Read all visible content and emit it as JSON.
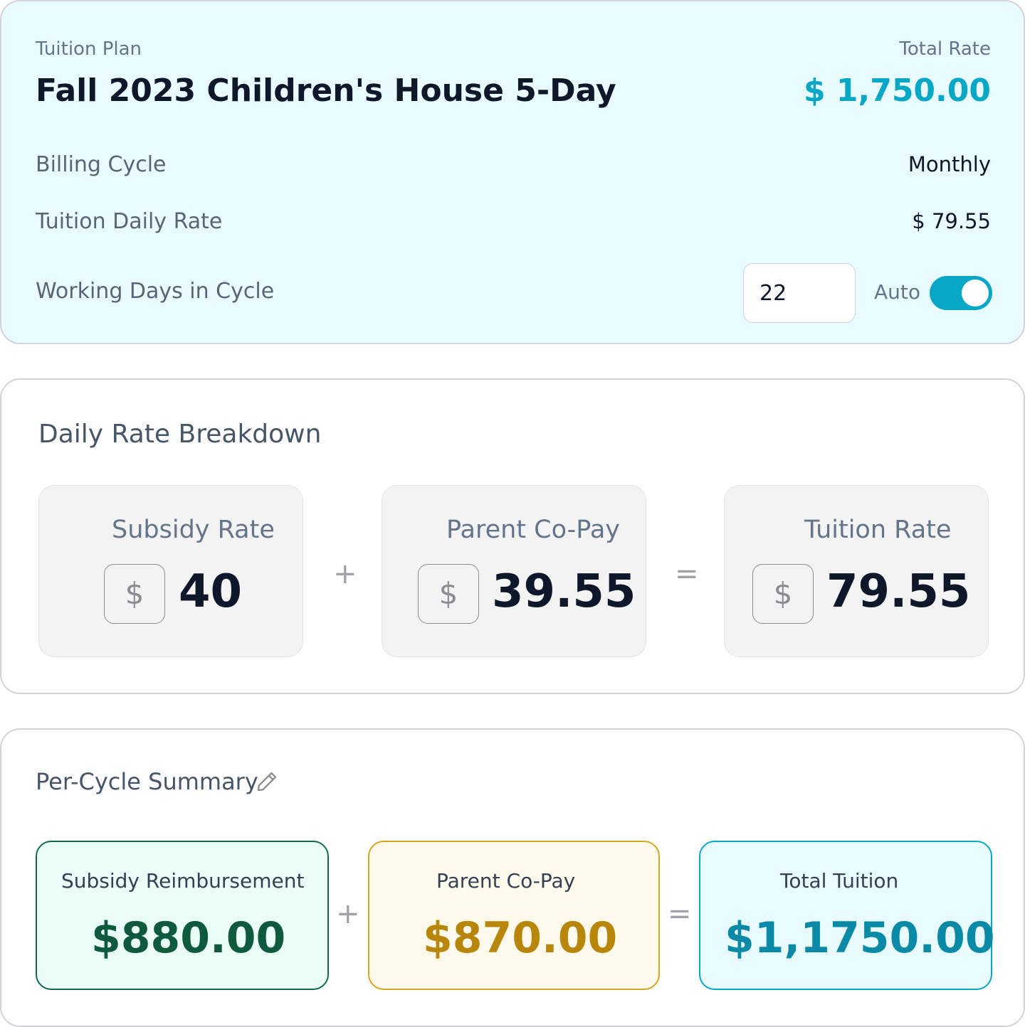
{
  "plan": {
    "plan_label": "Tuition Plan",
    "plan_name": "Fall 2023 Children's House 5-Day",
    "total_rate_label": "Total Rate",
    "total_rate_value": "$ 1,750.00",
    "billing_cycle_label": "Billing Cycle",
    "billing_cycle_value": "Monthly",
    "daily_rate_label": "Tuition Daily Rate",
    "daily_rate_value": "$ 79.55",
    "working_days_label": "Working Days in Cycle",
    "working_days_value": "22",
    "auto_label": "Auto",
    "auto_enabled": true
  },
  "daily_breakdown": {
    "title": "Daily Rate Breakdown",
    "currency_symbol": "$",
    "items": [
      {
        "label": "Subsidy Rate",
        "value": "40"
      },
      {
        "label": "Parent Co-Pay",
        "value": "39.55"
      },
      {
        "label": "Tuition Rate",
        "value": "79.55"
      }
    ],
    "plus": "+",
    "equals": "="
  },
  "cycle_summary": {
    "title": "Per-Cycle Summary",
    "edit_icon": "pencil-icon",
    "items": [
      {
        "label": "Subsidy Reimbursement",
        "value": "$880.00",
        "color": "#0f5a3c"
      },
      {
        "label": "Parent Co-Pay",
        "value": "$870.00",
        "color": "#b8860b"
      },
      {
        "label": "Total Tuition",
        "value": "$1,1750.00",
        "color": "#0a8aa6"
      }
    ],
    "plus": "+",
    "equals": "="
  },
  "colors": {
    "accent": "#08a7c5",
    "plan_background": "#e8fbff",
    "subsidy_background": "#eafdf6",
    "copay_background": "#fffaeb"
  }
}
